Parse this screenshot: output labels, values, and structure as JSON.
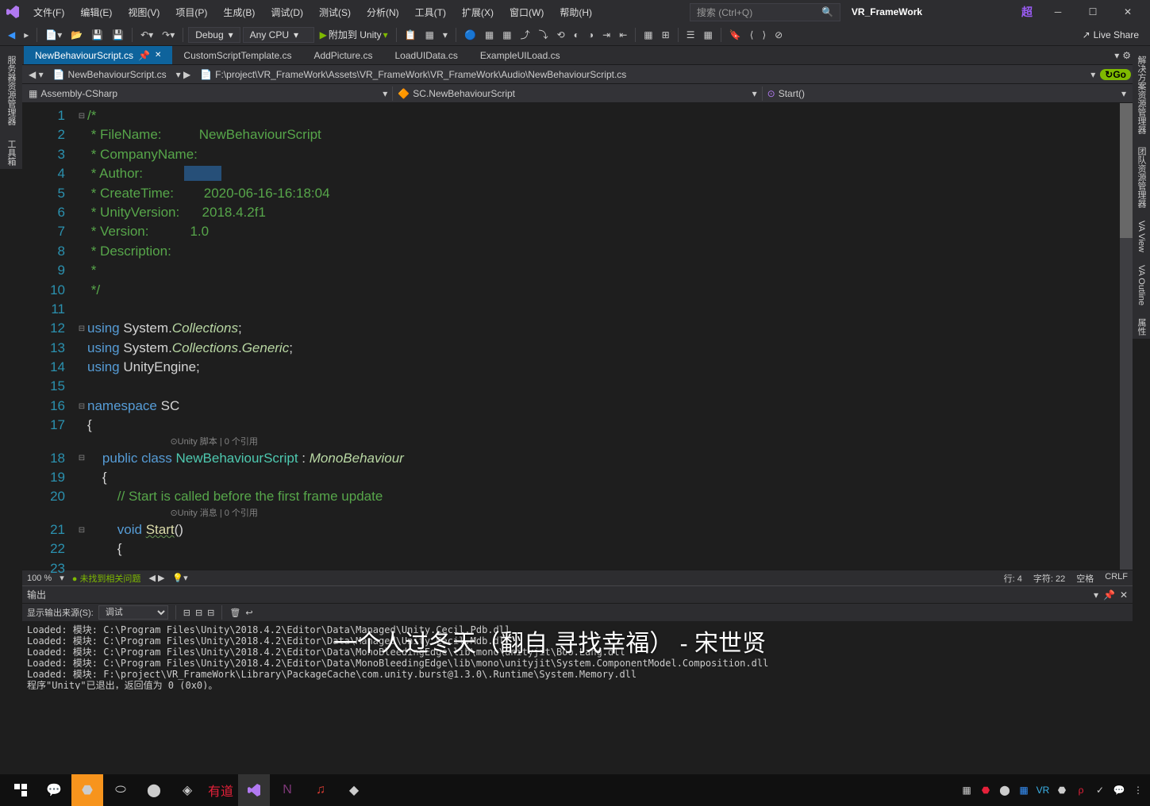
{
  "titlebar": {
    "menus": [
      "文件(F)",
      "编辑(E)",
      "视图(V)",
      "项目(P)",
      "生成(B)",
      "调试(D)",
      "测试(S)",
      "分析(N)",
      "工具(T)",
      "扩展(X)",
      "窗口(W)",
      "帮助(H)"
    ],
    "search_placeholder": "搜索 (Ctrl+Q)",
    "solution": "VR_FrameWork",
    "chao": "超"
  },
  "toolbar": {
    "config": "Debug",
    "platform": "Any CPU",
    "attach": "附加到 Unity",
    "live_share": "Live Share"
  },
  "tabs": [
    {
      "label": "NewBehaviourScript.cs",
      "active": true,
      "pinned": true
    },
    {
      "label": "CustomScriptTemplate.cs",
      "active": false
    },
    {
      "label": "AddPicture.cs",
      "active": false
    },
    {
      "label": "LoadUIData.cs",
      "active": false
    },
    {
      "label": "ExampleUILoad.cs",
      "active": false
    }
  ],
  "nav": {
    "file_dd": "NewBehaviourScript.cs",
    "path": "F:\\project\\VR_FrameWork\\Assets\\VR_FrameWork\\VR_FrameWork\\Audio\\NewBehaviourScript.cs",
    "go": "Go",
    "project": "Assembly-CSharp",
    "class": "SC.NewBehaviourScript",
    "member": "Start()"
  },
  "code": {
    "lines_count": 23,
    "comment_block": {
      "filename_label": " * FileName:          ",
      "filename_value": "NewBehaviourScript",
      "company_label": " * CompanyName:",
      "author_label": " * Author:           ",
      "author_value": "          ",
      "createtime_label": " * CreateTime:        ",
      "createtime_value": "2020-06-16-16:18:04",
      "unityversion_label": " * UnityVersion:      ",
      "unityversion_value": "2018.4.2f1",
      "version_label": " * Version:           ",
      "version_value": "1.0",
      "description_label": " * Description:",
      "star": " *",
      "end": " */"
    },
    "using1_ns": "System",
    "using1_sub": "Collections",
    "using2_ns": "System",
    "using2_sub": "Collections",
    "using2_sub2": "Generic",
    "using3": "UnityEngine",
    "namespace": "SC",
    "codelens1": "⊙Unity 脚本 | 0 个引用",
    "class_name": "NewBehaviourScript",
    "base_class": "MonoBehaviour",
    "comment_start": "// Start is called before the first frame update",
    "codelens2": "⊙Unity 消息 | 0 个引用",
    "method": "Start"
  },
  "status": {
    "zoom": "100 %",
    "issues": "未找到相关问题",
    "line": "行: 4",
    "col": "字符: 22",
    "ins": "空格",
    "eol": "CRLF"
  },
  "output": {
    "title": "输出",
    "source_label": "显示输出来源(S):",
    "source_value": "调试",
    "lines": [
      "Loaded: 模块: C:\\Program Files\\Unity\\2018.4.2\\Editor\\Data\\Managed\\Unity.Cecil.Pdb.dll",
      "Loaded: 模块: C:\\Program Files\\Unity\\2018.4.2\\Editor\\Data\\Managed\\Unity.Cecil.Mdb.dll",
      "Loaded: 模块: C:\\Program Files\\Unity\\2018.4.2\\Editor\\Data\\MonoBleedingEdge\\lib\\mono\\unityjit\\Boo.Lang.dll",
      "Loaded: 模块: C:\\Program Files\\Unity\\2018.4.2\\Editor\\Data\\MonoBleedingEdge\\lib\\mono\\unityjit\\System.ComponentModel.Composition.dll",
      "Loaded: 模块: F:\\project\\VR_FrameWork\\Library\\PackageCache\\com.unity.burst@1.3.0\\.Runtime\\System.Memory.dll",
      "程序\"Unity\"已退出，返回值为 0 (0x0)。"
    ]
  },
  "overlay": "一个人过冬天（翻自 寻找幸福） - 宋世贤",
  "right_panels": [
    "解决方案资源管理器",
    "团队资源管理器",
    "VA View",
    "VA Outline",
    "属性"
  ],
  "left_panels": [
    "服务器资源管理器",
    "工具箱"
  ]
}
